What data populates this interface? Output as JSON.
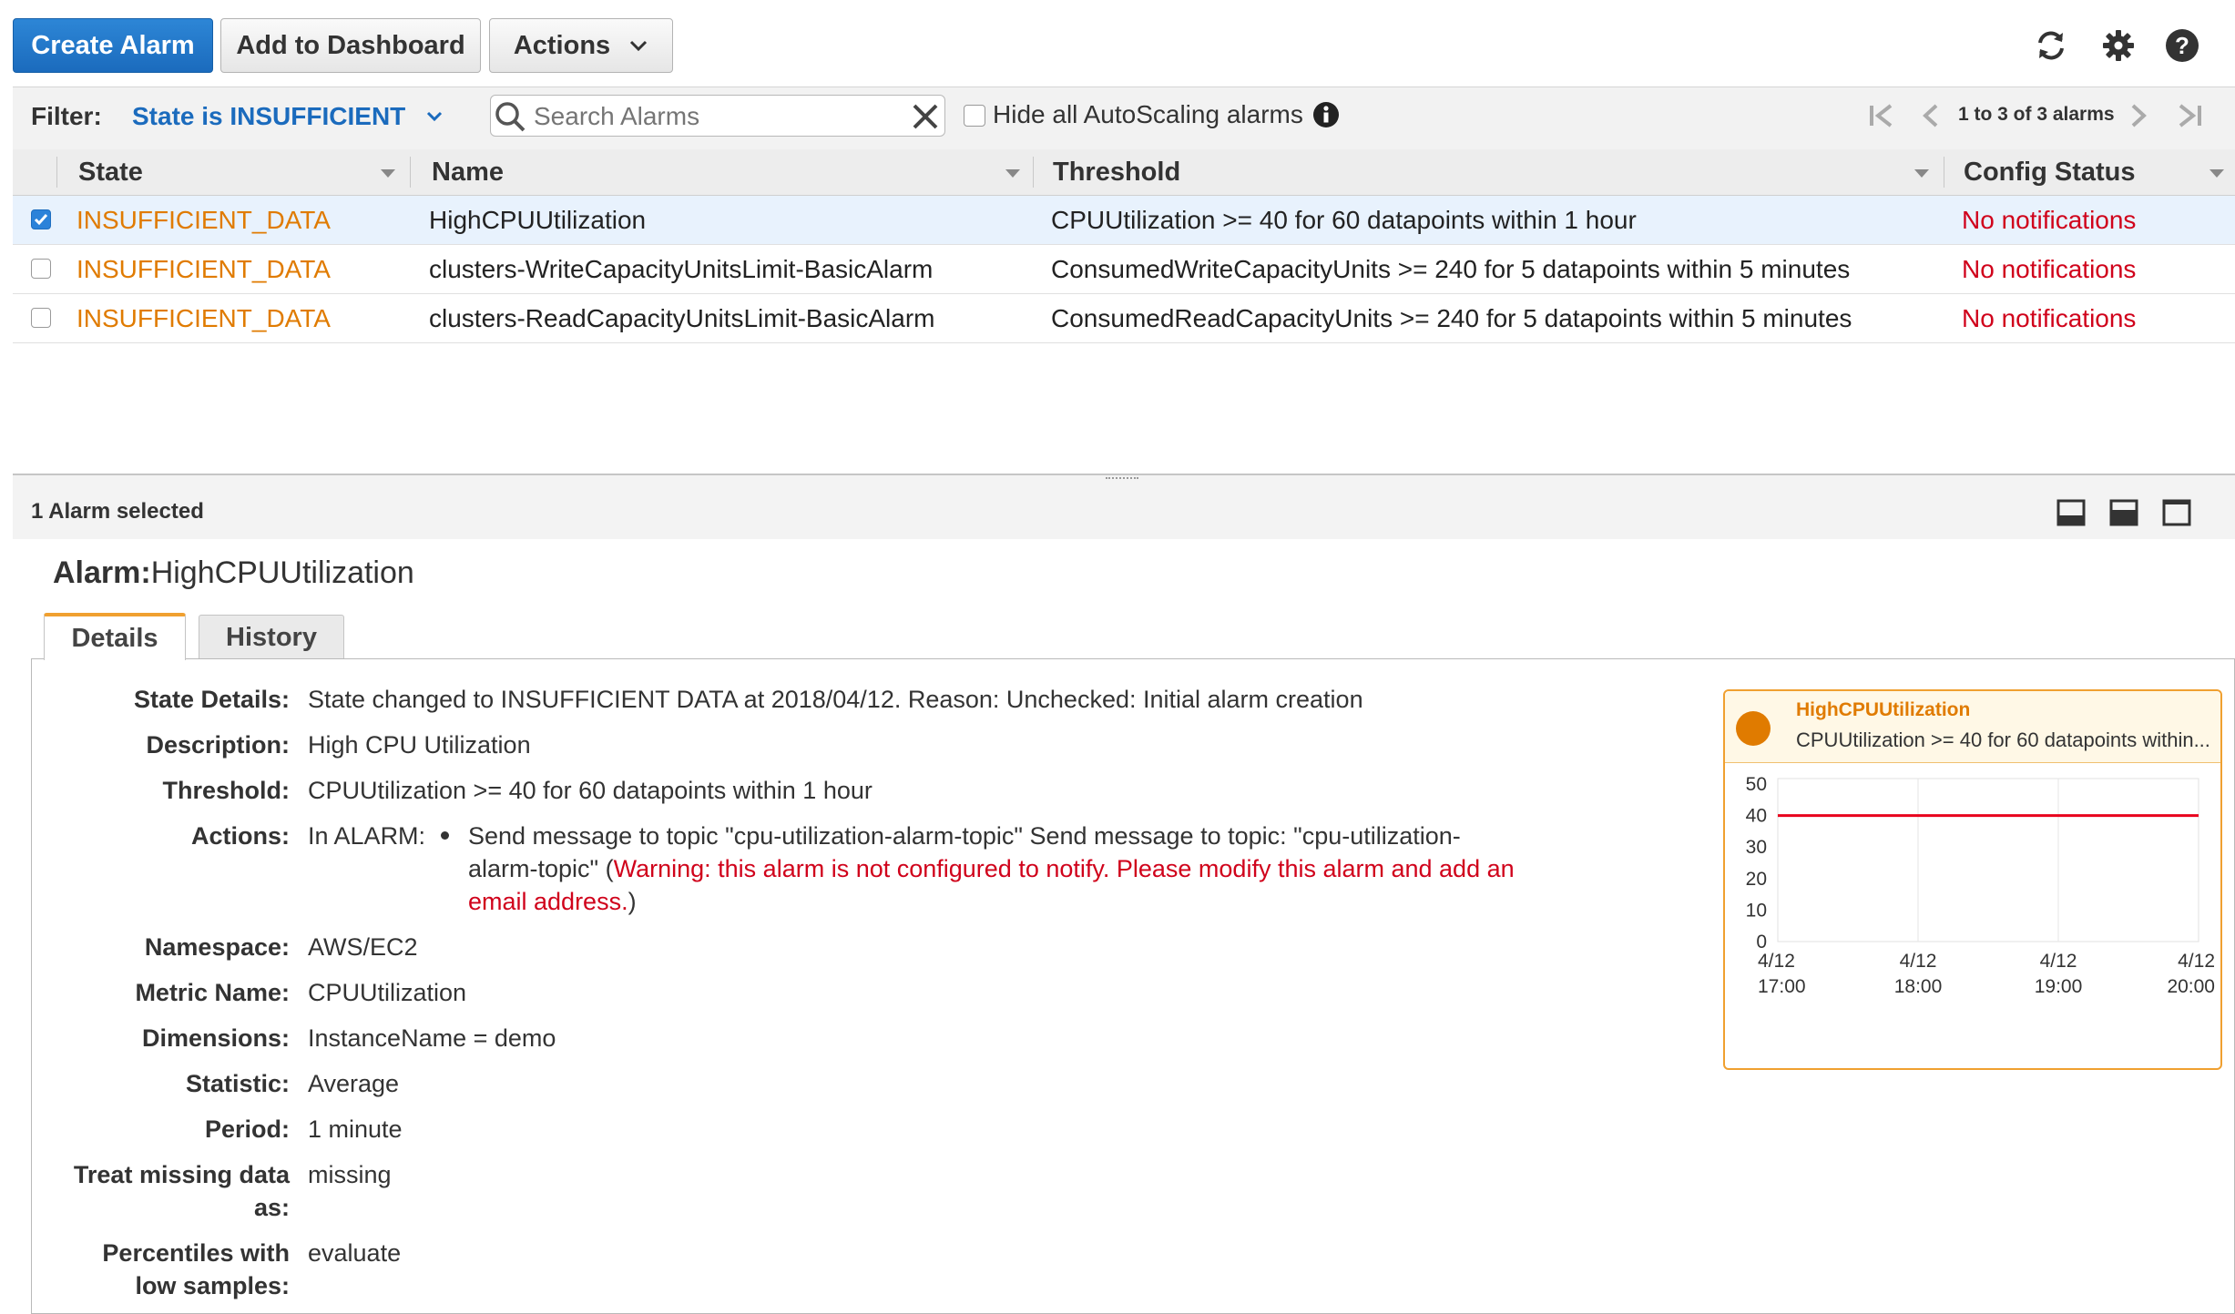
{
  "toolbar": {
    "create_alarm": "Create Alarm",
    "add_to_dashboard": "Add to Dashboard",
    "actions": "Actions",
    "icons": [
      "refresh-icon",
      "gear-icon",
      "help-icon"
    ]
  },
  "filter": {
    "label": "Filter:",
    "selected": "State is INSUFFICIENT",
    "search_placeholder": "Search Alarms",
    "hide_autoscaling_label": "Hide all AutoScaling alarms",
    "hide_autoscaling_checked": false,
    "pagination": "1 to 3 of 3 alarms"
  },
  "table": {
    "columns": [
      "State",
      "Name",
      "Threshold",
      "Config Status"
    ],
    "rows": [
      {
        "selected": true,
        "state": "INSUFFICIENT_DATA",
        "name": "HighCPUUtilization",
        "threshold": "CPUUtilization >= 40 for 60 datapoints within 1 hour",
        "config_status": "No notifications"
      },
      {
        "selected": false,
        "state": "INSUFFICIENT_DATA",
        "name": "clusters-WriteCapacityUnitsLimit-BasicAlarm",
        "threshold": "ConsumedWriteCapacityUnits >= 240 for 5 datapoints within 5 minutes",
        "config_status": "No notifications"
      },
      {
        "selected": false,
        "state": "INSUFFICIENT_DATA",
        "name": "clusters-ReadCapacityUnitsLimit-BasicAlarm",
        "threshold": "ConsumedReadCapacityUnits >= 240 for 5 datapoints within 5 minutes",
        "config_status": "No notifications"
      }
    ]
  },
  "detail": {
    "selected_count": "1 Alarm selected",
    "alarm_prefix": "Alarm:",
    "alarm_name": "HighCPUUtilization",
    "tabs": [
      "Details",
      "History"
    ],
    "active_tab": "Details",
    "fields": {
      "state_details_label": "State Details:",
      "state_details": "State changed to INSUFFICIENT DATA at 2018/04/12. Reason: Unchecked: Initial alarm creation",
      "description_label": "Description:",
      "description": "High CPU Utilization",
      "threshold_label": "Threshold:",
      "threshold": "CPUUtilization >= 40 for 60 datapoints within 1 hour",
      "actions_label": "Actions:",
      "actions_prefix": "In ALARM:",
      "actions_line1": "Send message to topic \"cpu-utilization-alarm-topic\" Send message to topic: \"cpu-utilization-",
      "actions_line2_plain": "alarm-topic\" (",
      "actions_line2_warn": "Warning: this alarm is not configured to notify. Please modify this alarm and add an",
      "actions_line3_warn": "email address.",
      "actions_line3_close": ")",
      "namespace_label": "Namespace:",
      "namespace": "AWS/EC2",
      "metric_name_label": "Metric Name:",
      "metric_name": "CPUUtilization",
      "dimensions_label": "Dimensions:",
      "dimensions": "InstanceName = demo",
      "statistic_label": "Statistic:",
      "statistic": "Average",
      "period_label": "Period:",
      "period": "1 minute",
      "treat_missing_label_1": "Treat missing data",
      "treat_missing_label_2": "as:",
      "treat_missing": "missing",
      "percentiles_label_1": "Percentiles with",
      "percentiles_label_2": "low samples:",
      "percentiles": "evaluate"
    }
  },
  "chart": {
    "title": "HighCPUUtilization",
    "subtitle": "CPUUtilization >= 40 for 60 datapoints within...",
    "accent_color": "#e07b00",
    "threshold_color": "#e8001c"
  },
  "chart_data": {
    "type": "line",
    "title": "HighCPUUtilization",
    "subtitle": "CPUUtilization >= 40 for 60 datapoints within...",
    "x_tick_labels": [
      [
        "4/12",
        "17:00"
      ],
      [
        "4/12",
        "18:00"
      ],
      [
        "4/12",
        "19:00"
      ],
      [
        "4/12",
        "20:00"
      ]
    ],
    "y_ticks": [
      0,
      10,
      20,
      30,
      40,
      50
    ],
    "ylim": [
      0,
      50
    ],
    "xlim": [
      "4/12 17:00",
      "4/12 20:00"
    ],
    "series": [
      {
        "values": [
          40,
          40,
          40,
          40
        ],
        "color": "#e8001c"
      }
    ],
    "grid": true
  }
}
